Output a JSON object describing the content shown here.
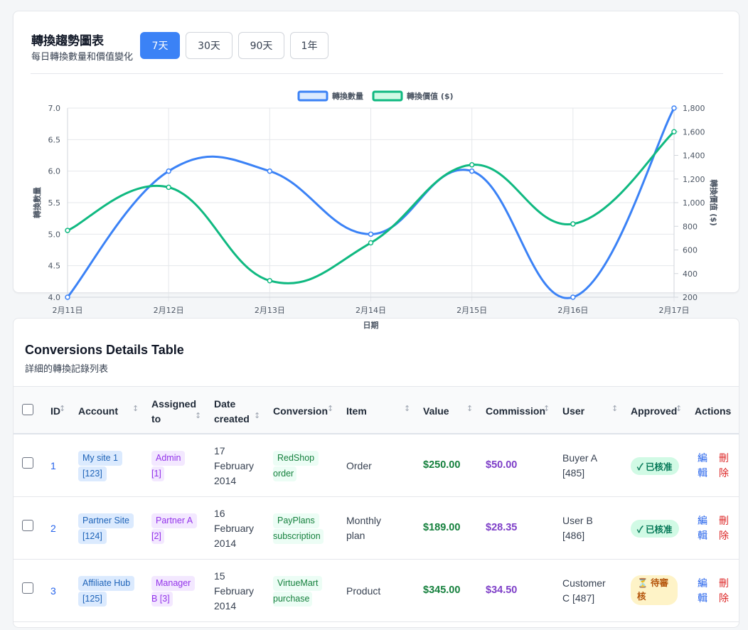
{
  "chart_card": {
    "title": "轉換趨勢圖表",
    "subtitle": "每日轉換數量和價值變化",
    "range_buttons": [
      {
        "label": "7天",
        "active": true
      },
      {
        "label": "30天",
        "active": false
      },
      {
        "label": "90天",
        "active": false
      },
      {
        "label": "1年",
        "active": false
      }
    ]
  },
  "chart_data": {
    "type": "line",
    "x": [
      "2月11日",
      "2月12日",
      "2月13日",
      "2月14日",
      "2月15日",
      "2月16日",
      "2月17日"
    ],
    "xlabel": "日期",
    "series": [
      {
        "name": "轉換數量",
        "axis": "left",
        "color": "#3b82f6",
        "values": [
          4,
          6,
          6,
          5,
          6,
          4,
          7
        ]
      },
      {
        "name": "轉換價值 ($)",
        "axis": "right",
        "color": "#10b981",
        "values": [
          765,
          1130,
          340,
          660,
          1320,
          820,
          1600
        ]
      }
    ],
    "y_left": {
      "label": "轉換數量",
      "min": 4.0,
      "max": 7.0,
      "ticks": [
        "4.0",
        "4.5",
        "5.0",
        "5.5",
        "6.0",
        "6.5",
        "7.0"
      ]
    },
    "y_right": {
      "label": "轉換價值 ($)",
      "min": 200,
      "max": 1800,
      "ticks": [
        "200",
        "400",
        "600",
        "800",
        "1,000",
        "1,200",
        "1,400",
        "1,600",
        "1,800"
      ]
    },
    "legend": "top-center",
    "grid": true,
    "curve": "smooth"
  },
  "table": {
    "title": "Conversions Details Table",
    "subtitle": "詳細的轉換記錄列表",
    "columns": [
      "ID",
      "Account",
      "Assigned to",
      "Date created",
      "Conversion",
      "Item",
      "Value",
      "Commission",
      "User",
      "Approved",
      "Actions"
    ],
    "header": {
      "id": "ID",
      "account": "Account",
      "assigned_1": "Assigned",
      "assigned_2": "to",
      "date_1": "Date",
      "date_2": "created",
      "conversion": "Conversion",
      "item": "Item",
      "value": "Value",
      "commission": "Commission",
      "user": "User",
      "approved": "Approved",
      "actions": "Actions"
    },
    "rows": [
      {
        "id": "1",
        "account_1": "My site 1",
        "account_2": "[123]",
        "assigned_1": "Admin",
        "assigned_2": "[1]",
        "date_1": "17",
        "date_2": "February",
        "date_3": "2014",
        "conversion_1": "RedShop",
        "conversion_2": "order",
        "item_1": "Order",
        "item_2": "",
        "value": "$250.00",
        "commission": "$50.00",
        "user_1": "Buyer A",
        "user_2": "[485]",
        "status": "✓ 已核准",
        "status_type": "approved",
        "edit_1": "編",
        "edit_2": "輯",
        "delete_1": "刪",
        "delete_2": "除"
      },
      {
        "id": "2",
        "account_1": "Partner Site",
        "account_2": "[124]",
        "assigned_1": "Partner A",
        "assigned_2": "[2]",
        "date_1": "16",
        "date_2": "February",
        "date_3": "2014",
        "conversion_1": "PayPlans",
        "conversion_2": "subscription",
        "item_1": "Monthly",
        "item_2": "plan",
        "value": "$189.00",
        "commission": "$28.35",
        "user_1": "User B",
        "user_2": "[486]",
        "status": "✓ 已核准",
        "status_type": "approved",
        "edit_1": "編",
        "edit_2": "輯",
        "delete_1": "刪",
        "delete_2": "除"
      },
      {
        "id": "3",
        "account_1": "Affiliate Hub",
        "account_2": "[125]",
        "assigned_1": "Manager",
        "assigned_2": "B [3]",
        "date_1": "15",
        "date_2": "February",
        "date_3": "2014",
        "conversion_1": "VirtueMart",
        "conversion_2": "purchase",
        "item_1": "Product",
        "item_2": "",
        "value": "$345.00",
        "commission": "$34.50",
        "user_1": "Customer",
        "user_2": "C [487]",
        "status_1": "⏳ 待審",
        "status_2": "核",
        "status_type": "pending",
        "edit_1": "編",
        "edit_2": "輯",
        "delete_1": "刪",
        "delete_2": "除"
      }
    ],
    "sort_icon": "↕"
  }
}
